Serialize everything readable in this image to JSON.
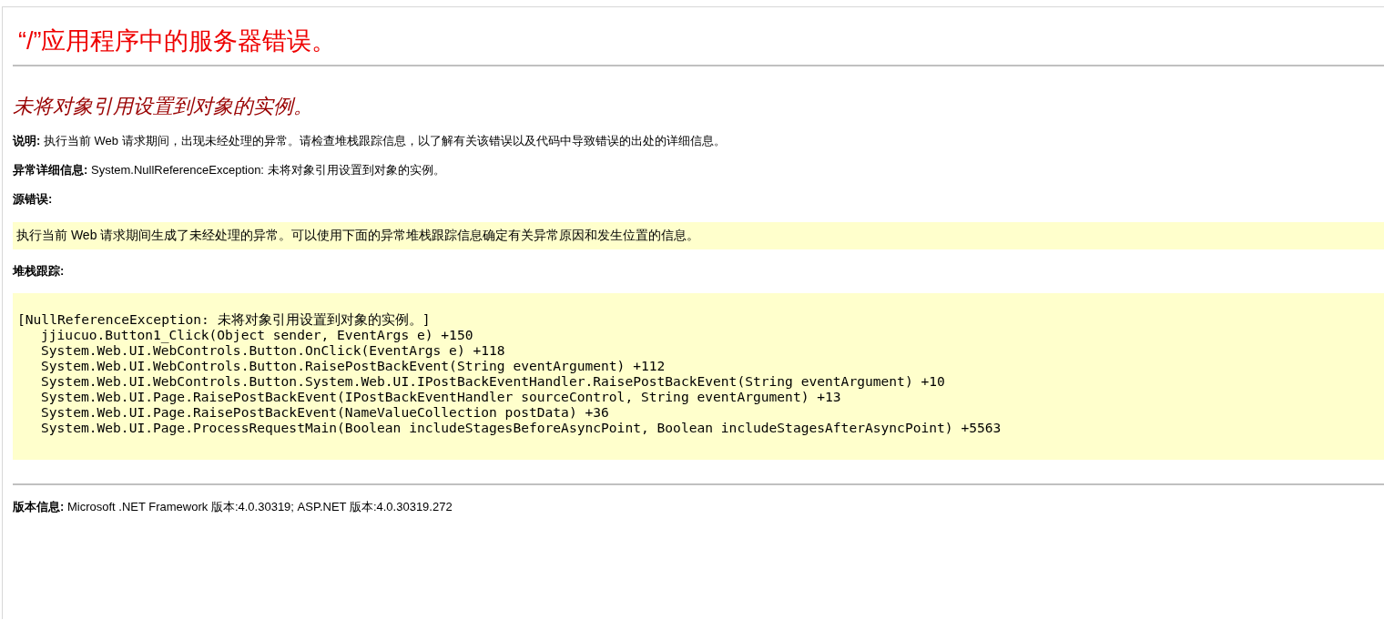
{
  "title": "“/”应用程序中的服务器错误。",
  "message": "未将对象引用设置到对象的实例。",
  "description": "**说明:** 执行当前 Web 请求期间，出现未经处理的异常。请检查堆栈跟踪信息，以了解有关该错误以及代码中导致错误的出处的详细信息。",
  "exception_details": "**异常详细信息:** System.NullReferenceException: 未将对象引用设置到对象的实例。",
  "source_error": {
    "heading": "源错误:",
    "text": "执行当前 Web 请求期间生成了未经处理的异常。可以使用下面的异常堆栈跟踪信息确定有关异常原因和发生位置的信息。"
  },
  "stack_trace": {
    "heading": "堆栈跟踪:",
    "lines": [
      {
        "kind": "exception",
        "text": "[NullReferenceException: 未将对象引用设置到对象的实例。]"
      },
      {
        "kind": "frame",
        "text": "jjiucuo.Button1_Click(Object sender, EventArgs e) +150"
      },
      {
        "kind": "frame",
        "text": "System.Web.UI.WebControls.Button.OnClick(EventArgs e) +118"
      },
      {
        "kind": "frame",
        "text": "System.Web.UI.WebControls.Button.RaisePostBackEvent(String eventArgument) +112"
      },
      {
        "kind": "frame",
        "text": "System.Web.UI.WebControls.Button.System.Web.UI.IPostBackEventHandler.RaisePostBackEvent(String eventArgument) +10"
      },
      {
        "kind": "frame",
        "text": "System.Web.UI.Page.RaisePostBackEvent(IPostBackEventHandler sourceControl, String eventArgument) +13"
      },
      {
        "kind": "frame",
        "text": "System.Web.UI.Page.RaisePostBackEvent(NameValueCollection postData) +36"
      },
      {
        "kind": "frame",
        "text": "System.Web.UI.Page.ProcessRequestMain(Boolean includeStagesBeforeAsyncPoint, Boolean includeStagesAfterAsyncPoint) +5563"
      }
    ]
  },
  "version_info": "**版本信息:** Microsoft .NET Framework 版本:4.0.30319; ASP.NET 版本:4.0.30319.272"
}
